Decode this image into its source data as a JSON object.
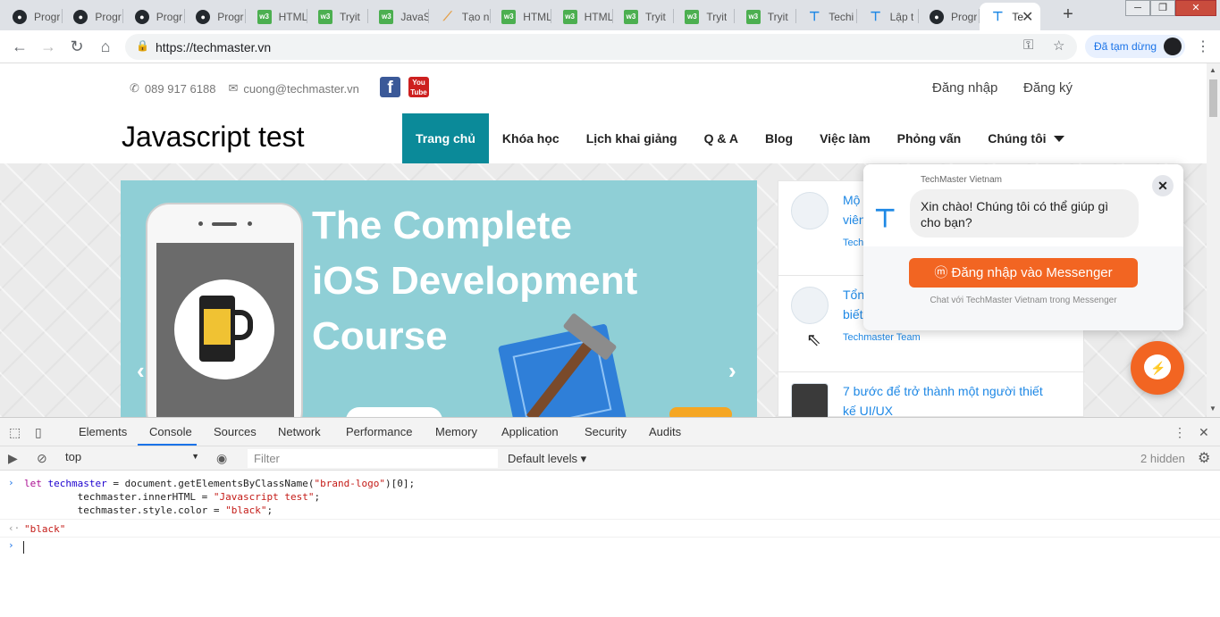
{
  "browser": {
    "tabs": [
      {
        "title": "Progr",
        "icon": "github-icon"
      },
      {
        "title": "Progr",
        "icon": "github-icon"
      },
      {
        "title": "Progr",
        "icon": "github-icon"
      },
      {
        "title": "Progr",
        "icon": "github-icon"
      },
      {
        "title": "HTML",
        "icon": "w3schools-icon"
      },
      {
        "title": "Tryit",
        "icon": "w3schools-icon"
      },
      {
        "title": "JavaS",
        "icon": "w3schools-icon"
      },
      {
        "title": "Tạo n",
        "icon": "viblo-icon"
      },
      {
        "title": "HTML",
        "icon": "w3schools-icon"
      },
      {
        "title": "HTML",
        "icon": "w3schools-icon"
      },
      {
        "title": "Tryit",
        "icon": "w3schools-icon"
      },
      {
        "title": "Tryit",
        "icon": "w3schools-icon"
      },
      {
        "title": "Tryit",
        "icon": "w3schools-icon"
      },
      {
        "title": "Techi",
        "icon": "techmaster-icon"
      },
      {
        "title": "Lập t",
        "icon": "techmaster-icon"
      },
      {
        "title": "Progr",
        "icon": "github-icon"
      },
      {
        "title": "Te",
        "icon": "techmaster-icon",
        "active": true
      }
    ],
    "url": "https://techmaster.vn",
    "profile_label": "Đã tạm dừng"
  },
  "site": {
    "phone": "089 917 6188",
    "email": "cuong@techmaster.vn",
    "login": "Đăng nhập",
    "register": "Đăng ký",
    "brand": "Javascript test",
    "nav": [
      "Trang chủ",
      "Khóa học",
      "Lịch khai giảng",
      "Q & A",
      "Blog",
      "Việc làm",
      "Phỏng vấn",
      "Chúng tôi"
    ],
    "hero_title_lines": [
      "The Complete",
      "iOS Development",
      "Course"
    ],
    "posts": [
      {
        "title": "Mộ",
        "title2": "viên",
        "author": "Tech"
      },
      {
        "title": "Tổn",
        "title2": "biết",
        "author": "Techmaster Team"
      },
      {
        "title": "7 bước để trở thành một người thiết",
        "title2": "kế UI/UX",
        "author": ""
      }
    ]
  },
  "messenger": {
    "page_name": "TechMaster Vietnam",
    "greeting": "Xin chào! Chúng tôi có thể giúp gì cho bạn?",
    "login_button": "Đăng nhập vào Messenger",
    "note": "Chat với TechMaster Vietnam trong Messenger"
  },
  "devtools": {
    "tabs": [
      "Elements",
      "Console",
      "Sources",
      "Network",
      "Performance",
      "Memory",
      "Application",
      "Security",
      "Audits"
    ],
    "active_tab": "Console",
    "context": "top",
    "filter_placeholder": "Filter",
    "levels": "Default levels",
    "hidden": "2 hidden",
    "console_input": {
      "line1_kw": "let",
      "line1_var": "techmaster",
      "line1_rest": " = document.getElementsByClassName(",
      "line1_str": "\"brand-logo\"",
      "line1_end": ")[0];",
      "line2_pre": "         techmaster.innerHTML = ",
      "line2_str": "\"Javascript test\"",
      "line2_end": ";",
      "line3_pre": "         techmaster.style.color = ",
      "line3_str": "\"black\"",
      "line3_end": ";"
    },
    "console_result": "\"black\""
  }
}
